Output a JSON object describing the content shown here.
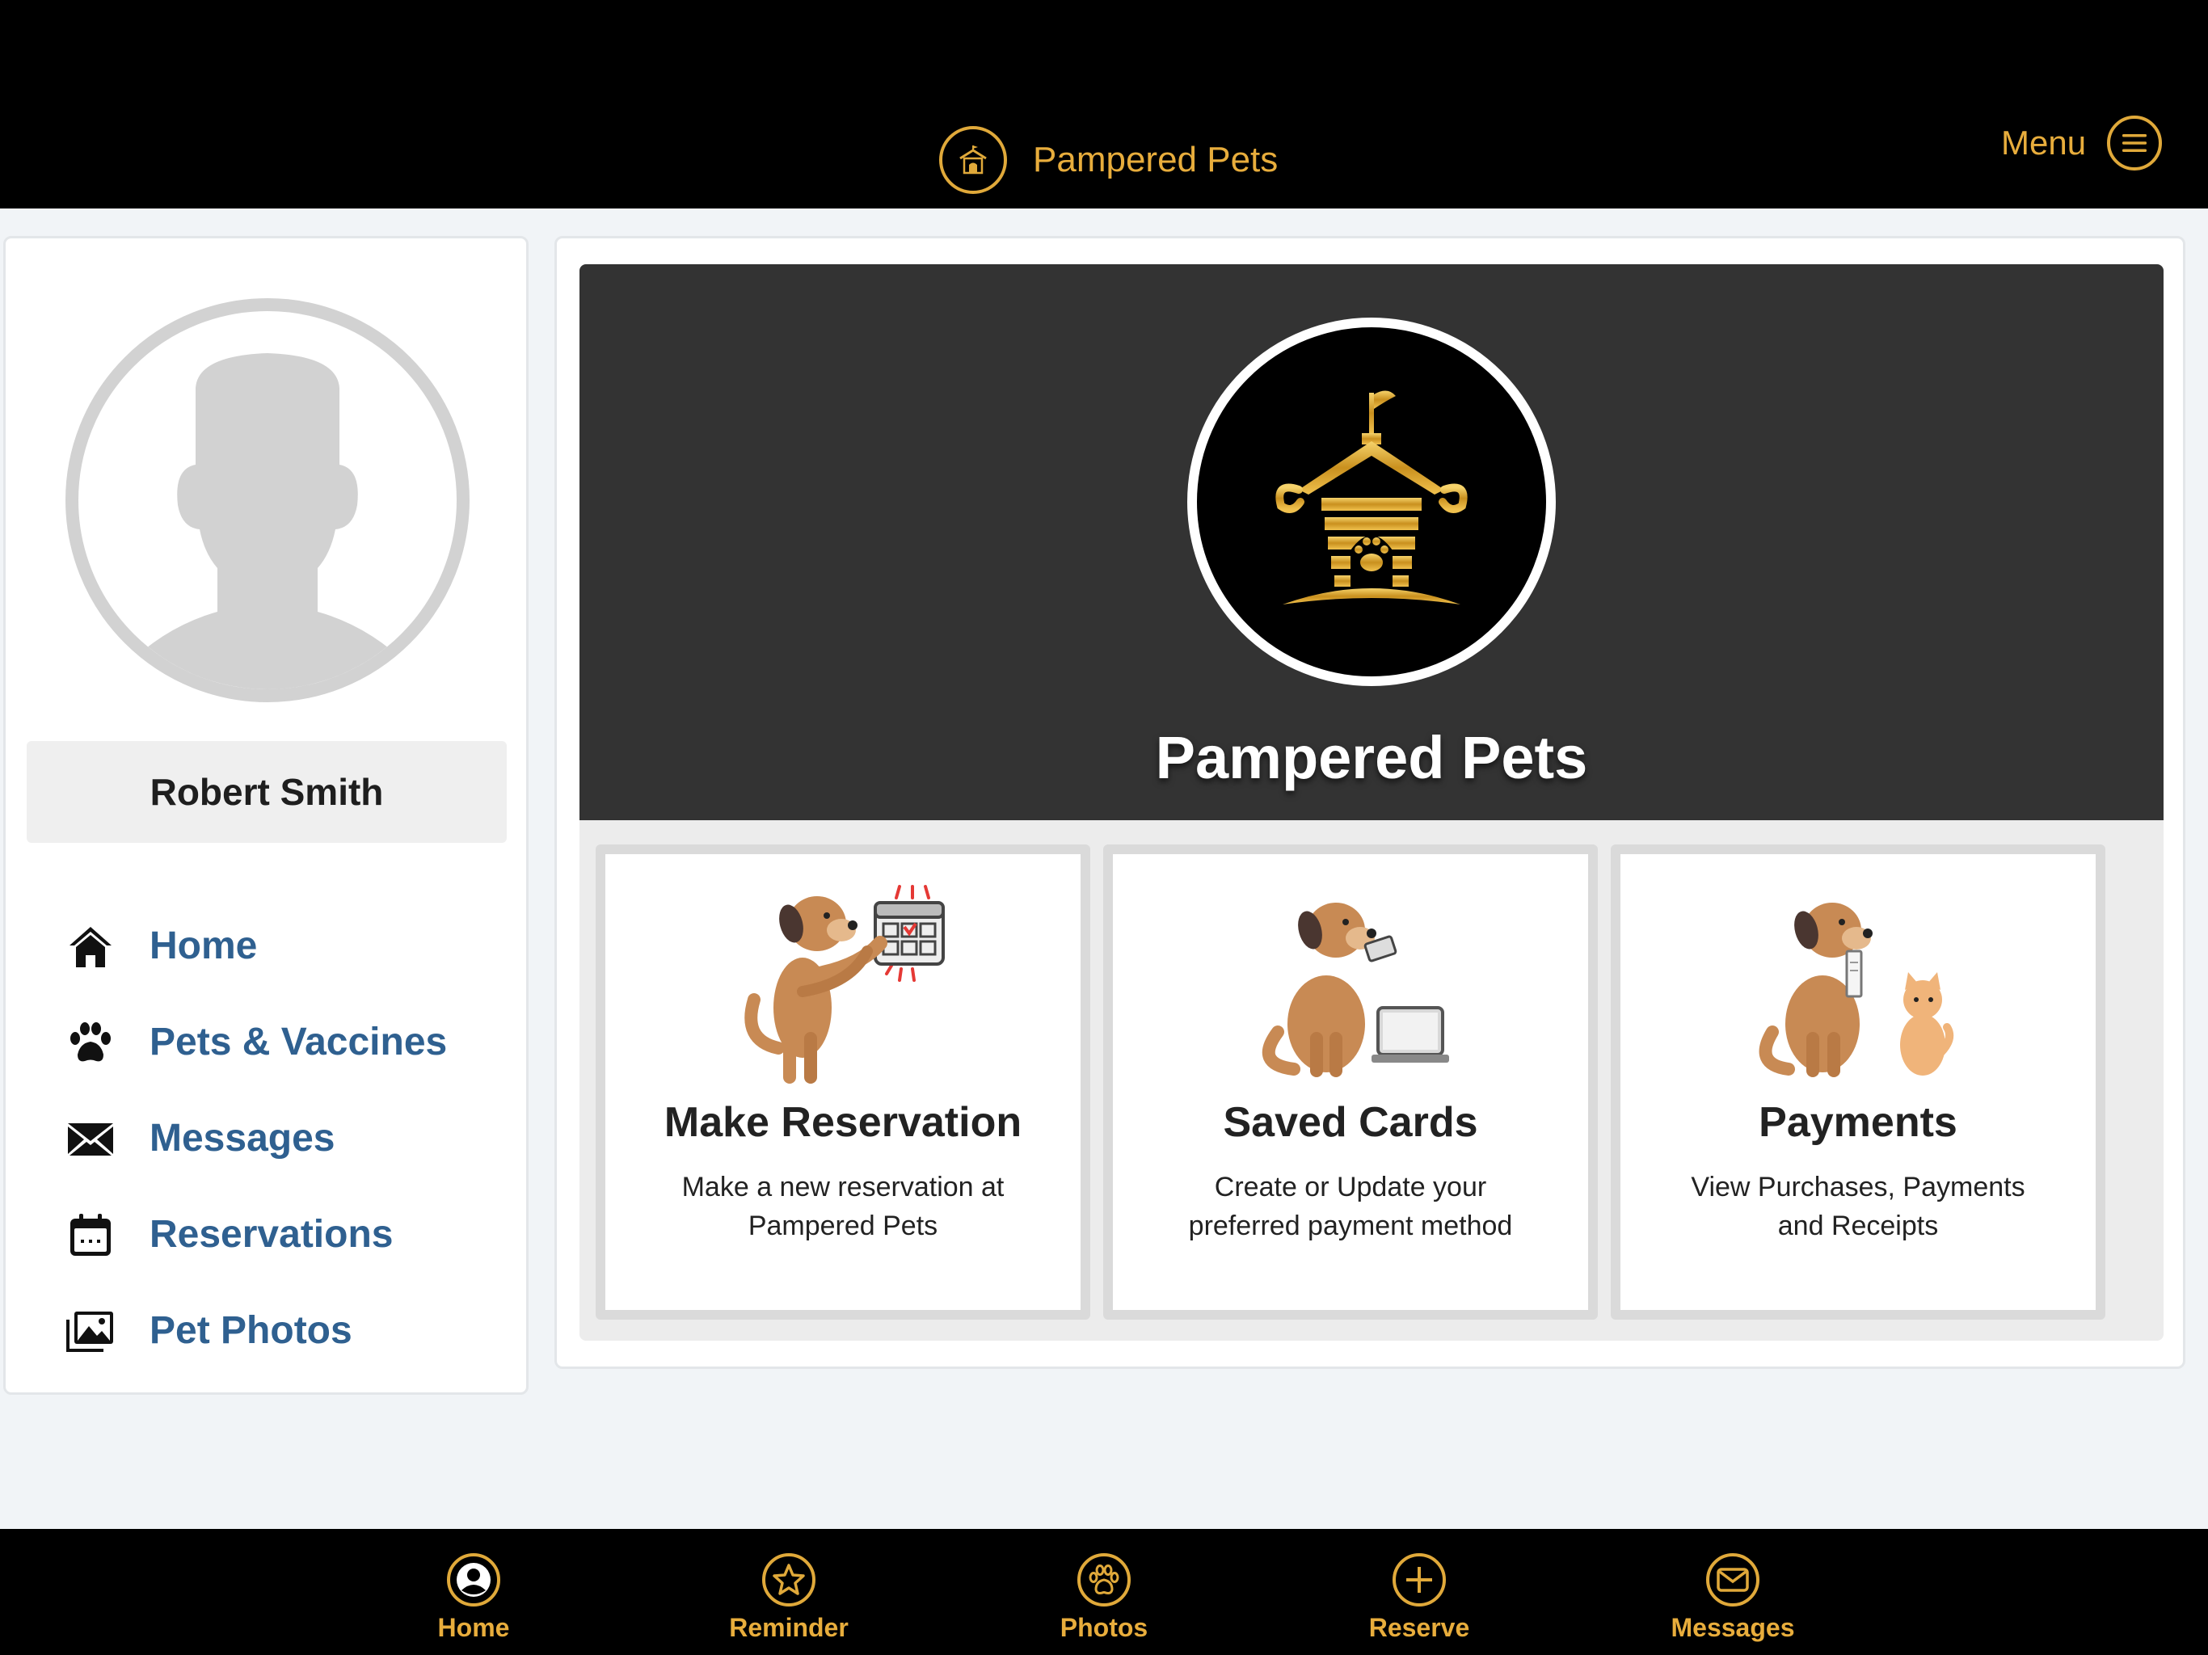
{
  "header": {
    "brand_title": "Pampered Pets",
    "menu_label": "Menu",
    "accent_color": "#e8ad3c"
  },
  "profile": {
    "name": "Robert Smith"
  },
  "sidebar": {
    "items": [
      {
        "label": "Home",
        "icon": "home-icon"
      },
      {
        "label": "Pets & Vaccines",
        "icon": "paw-icon"
      },
      {
        "label": "Messages",
        "icon": "envelope-icon"
      },
      {
        "label": "Reservations",
        "icon": "calendar-icon"
      },
      {
        "label": "Pet Photos",
        "icon": "photos-icon"
      }
    ],
    "link_color": "#2f6090"
  },
  "hero": {
    "title": "Pampered Pets"
  },
  "cards": [
    {
      "title": "Make Reservation",
      "desc_line1": "Make a new reservation at",
      "desc_line2": "Pampered Pets"
    },
    {
      "title": "Saved Cards",
      "desc_line1": "Create or Update your",
      "desc_line2": "preferred payment method"
    },
    {
      "title": "Payments",
      "desc_line1": "View Purchases, Payments",
      "desc_line2": "and Receipts"
    }
  ],
  "tabbar": {
    "tabs": [
      {
        "label": "Home",
        "icon": "user-circle-icon"
      },
      {
        "label": "Reminder",
        "icon": "star-icon"
      },
      {
        "label": "Photos",
        "icon": "paw-icon"
      },
      {
        "label": "Reserve",
        "icon": "plus-icon"
      },
      {
        "label": "Messages",
        "icon": "envelope-icon"
      }
    ]
  }
}
